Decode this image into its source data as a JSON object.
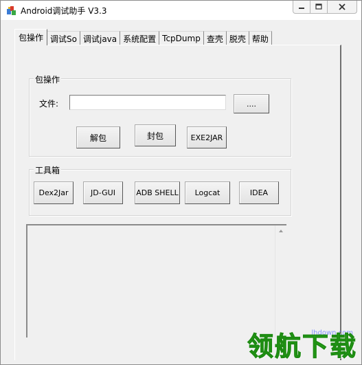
{
  "window": {
    "title": "Android调试助手 V3.3",
    "icon": "app-icon",
    "controls": [
      "minimize-icon",
      "maximize-icon",
      "close-icon"
    ]
  },
  "tabs": [
    {
      "label": "包操作",
      "active": true
    },
    {
      "label": "调试So",
      "active": false
    },
    {
      "label": "调试java",
      "active": false
    },
    {
      "label": "系统配置",
      "active": false
    },
    {
      "label": "TcpDump",
      "active": false
    },
    {
      "label": "查壳",
      "active": false
    },
    {
      "label": "脱壳",
      "active": false
    },
    {
      "label": "帮助",
      "active": false
    }
  ],
  "package_group": {
    "title": "包操作",
    "file_label": "文件:",
    "file_value": "",
    "browse_label": "....",
    "unpack_label": "解包",
    "pack_label": "封包",
    "exe2jar_label": "EXE2JAR"
  },
  "toolbox_group": {
    "title": "工具箱",
    "buttons": [
      "Dex2Jar",
      "JD-GUI",
      "ADB SHELL",
      "Logcat",
      "IDEA"
    ]
  },
  "output": {
    "text": ""
  },
  "watermark": {
    "url": "lhdown.com",
    "text": "领航下载"
  },
  "colors": {
    "window_bg": "#f0f0f0",
    "watermark_green": "#2aa81a",
    "watermark_url": "#6a7cff"
  }
}
